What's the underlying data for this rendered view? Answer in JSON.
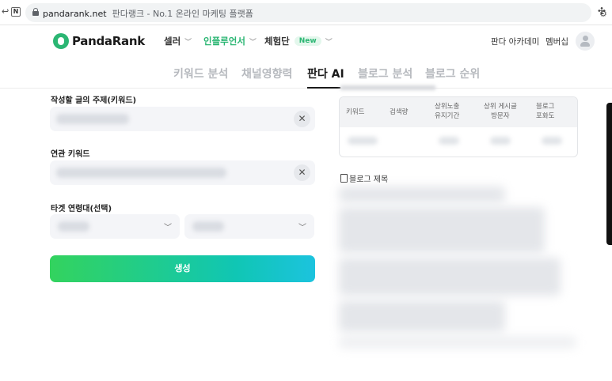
{
  "browser": {
    "url": "pandarank.net",
    "page_title": "판다랭크 - No.1 온라인 마케팅 플랫폼",
    "nav_icon": "N"
  },
  "header": {
    "logo_text": "PandaRank",
    "nav": [
      {
        "label": "셀러"
      },
      {
        "label": "인플루언서"
      },
      {
        "label": "체험단",
        "badge": "New"
      }
    ],
    "academy": "판다 아카데미",
    "membership": "멤버십"
  },
  "tabs": [
    {
      "label": "키워드 분석",
      "active": false
    },
    {
      "label": "채널영향력",
      "active": false
    },
    {
      "label": "판다 AI",
      "active": true
    },
    {
      "label": "블로그 분석",
      "active": false
    },
    {
      "label": "블로그 순위",
      "active": false
    }
  ],
  "form": {
    "topic_label": "작성할 글의 주제(키워드)",
    "related_label": "연관 키워드",
    "age_label": "타겟 연령대(선택)",
    "clear_icon": "✕",
    "generate_label": "생성"
  },
  "result_table": {
    "headers": [
      "키워드",
      "검색량",
      "상위노출\n유지기간",
      "상위 게시글\n방문자",
      "블로그\n포화도"
    ]
  },
  "blog_title_label": "블로그 제목",
  "colors": {
    "brand_green": "#2bb673",
    "generate_gradient_start": "#33d35e",
    "generate_gradient_end": "#1cc3de"
  }
}
